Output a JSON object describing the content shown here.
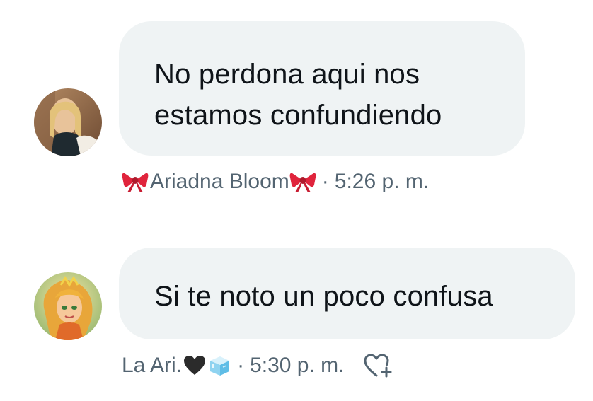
{
  "messages": [
    {
      "text": "No perdona aqui nos\nestamos confundiendo",
      "sender": "Ariadna Bloom",
      "sender_emoji": "bow-icon",
      "time": "5:26 p. m.",
      "separator": "·"
    },
    {
      "text": "Si te noto un poco confusa",
      "sender": "La Ari.",
      "sender_emoji": [
        "black-heart-icon",
        "ice-cube-icon"
      ],
      "time": "5:30 p. m.",
      "separator": "·",
      "reaction_icon": "add-reaction-heart-icon"
    }
  ],
  "colors": {
    "bubble_bg": "#eff3f4",
    "text": "#0f1419",
    "meta_text": "#536471",
    "bow": "#e0243c"
  }
}
